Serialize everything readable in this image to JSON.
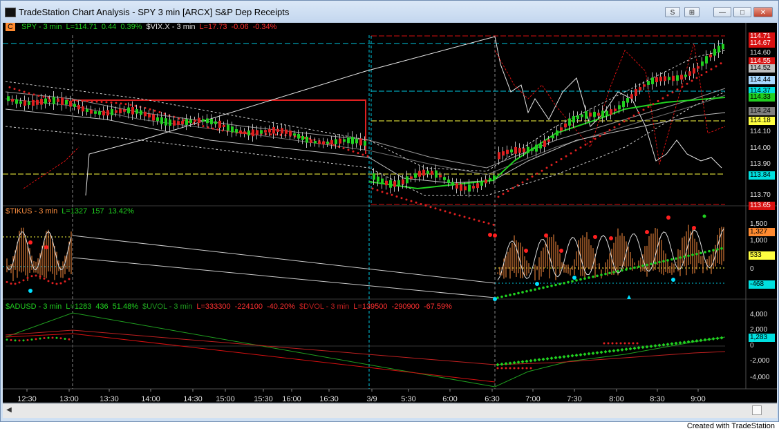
{
  "window": {
    "title": "TradeStation Chart Analysis - SPY 3 min [ARCX] S&P Dep Receipts",
    "btn_s": "S",
    "btn_grid": "⊞",
    "btn_min": "—",
    "btn_max": "□",
    "btn_close": "✕"
  },
  "pane1": {
    "badge": "C",
    "legend": [
      {
        "text": "SPY - 3 min",
        "color": "#20d020"
      },
      {
        "text": "L=114.71",
        "color": "#20d020"
      },
      {
        "text": "0.44",
        "color": "#20d020"
      },
      {
        "text": "0.39%",
        "color": "#20d020"
      },
      {
        "text": "$VIX.X - 3 min",
        "color": "#e0e0e0"
      },
      {
        "text": "L=17.73",
        "color": "#ff3030"
      },
      {
        "text": "-0.06",
        "color": "#ff3030"
      },
      {
        "text": "-0.34%",
        "color": "#ff3030"
      }
    ],
    "axis_labels": [
      "114.60",
      "114.10",
      "114.00",
      "113.90",
      "113.70"
    ],
    "price_tags": [
      {
        "text": "114.71",
        "bg": "#d81010",
        "color": "#ffffff"
      },
      {
        "text": "114.67",
        "bg": "#d81010",
        "color": "#ffffff"
      },
      {
        "text": "114.55",
        "bg": "#d81010",
        "color": "#ffffff"
      },
      {
        "text": "114.52",
        "bg": "#c0c0c0",
        "color": "#000000"
      },
      {
        "text": "114.44",
        "bg": "#a8d8ff",
        "color": "#000000"
      },
      {
        "text": "114.37",
        "bg": "#00e0e0",
        "color": "#000000"
      },
      {
        "text": "114.33",
        "bg": "#20d020",
        "color": "#000000"
      },
      {
        "text": "114.24",
        "bg": "#808080",
        "color": "#000000"
      },
      {
        "text": "114.18",
        "bg": "#ffff40",
        "color": "#000000"
      },
      {
        "text": "113.84",
        "bg": "#00e0e0",
        "color": "#000000"
      },
      {
        "text": "113.65",
        "bg": "#d81010",
        "color": "#ffffff"
      }
    ]
  },
  "pane2": {
    "legend": [
      {
        "text": "$TIKUS - 3 min",
        "color": "#ff9040"
      },
      {
        "text": "L=1327",
        "color": "#20d020"
      },
      {
        "text": "157",
        "color": "#20d020"
      },
      {
        "text": "13.42%",
        "color": "#20d020"
      }
    ],
    "axis_labels": [
      "1,500",
      "1,000",
      "0"
    ],
    "price_tags": [
      {
        "text": "1,327",
        "bg": "#ff8a30",
        "color": "#000000"
      },
      {
        "text": "533",
        "bg": "#ffff40",
        "color": "#000000"
      },
      {
        "text": "-468",
        "bg": "#00e0e0",
        "color": "#000000"
      }
    ]
  },
  "pane3": {
    "legend": [
      {
        "text": "$ADUSD - 3 min",
        "color": "#20d020"
      },
      {
        "text": "L=1283",
        "color": "#20d020"
      },
      {
        "text": "436",
        "color": "#20d020"
      },
      {
        "text": "51.48%",
        "color": "#20d020"
      },
      {
        "text": "$UVOL - 3 min",
        "color": "#20a020"
      },
      {
        "text": "L=333300",
        "color": "#ff3030"
      },
      {
        "text": "-224100",
        "color": "#ff3030"
      },
      {
        "text": "-40.20%",
        "color": "#ff3030"
      },
      {
        "text": "$DVOL - 3 min",
        "color": "#c02020"
      },
      {
        "text": "L=139500",
        "color": "#ff3030"
      },
      {
        "text": "-290900",
        "color": "#ff3030"
      },
      {
        "text": "-67.59%",
        "color": "#ff3030"
      }
    ],
    "axis_labels": [
      "4,000",
      "2,000",
      "0",
      "-2,000",
      "-4,000"
    ],
    "price_tags": [
      {
        "text": "1,283",
        "bg": "#00e0e0",
        "color": "#000000"
      }
    ]
  },
  "time_axis": [
    "12:30",
    "13:00",
    "13:30",
    "14:00",
    "14:30",
    "15:00",
    "15:30",
    "16:00",
    "16:30",
    "3/9",
    "5:30",
    "6:00",
    "6:30",
    "7:00",
    "7:30",
    "8:00",
    "8:30",
    "9:00"
  ],
  "footer": "Created with TradeStation",
  "colors": {
    "up": "#20d020",
    "down": "#e02020",
    "background": "#000000"
  }
}
